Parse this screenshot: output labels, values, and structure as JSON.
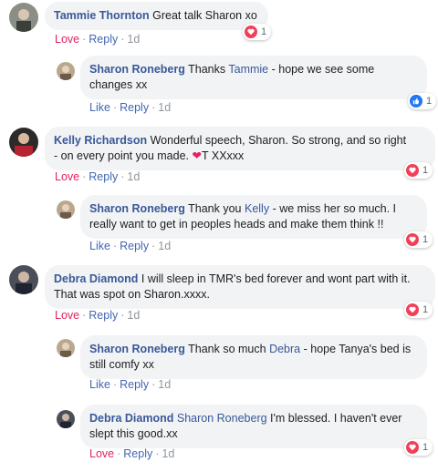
{
  "comments": [
    {
      "author": "Tammie Thornton",
      "text": "Great talk Sharon xo",
      "actions": {
        "love": "Love",
        "reply": "Reply",
        "time": "1d"
      },
      "reactions": {
        "type": "heart-icon",
        "count": "1"
      }
    },
    {
      "author": "Sharon Roneberg",
      "text_before": "Thanks",
      "mention": "Tammie",
      "text_after": "- hope we see some",
      "text_line2": "changes xx",
      "actions": {
        "like": "Like",
        "reply": "Reply",
        "time": "1d"
      },
      "reactions": {
        "type": "like-icon",
        "count": "1"
      }
    },
    {
      "author": "Kelly Richardson",
      "text": "Wonderful speech, Sharon. So strong, and so right",
      "text_line2_before": "- on every point you made.",
      "emoji": "heart-emoji",
      "emoji_char": "❤",
      "text_line2_after": "T XXxxx",
      "actions": {
        "love": "Love",
        "reply": "Reply",
        "time": "1d"
      },
      "reactions": {
        "type": "heart-icon",
        "count": "1"
      }
    },
    {
      "author": "Sharon Roneberg",
      "text_before": "Thank you",
      "mention": "Kelly",
      "text_after": "- we miss her so much. I",
      "text_line2": "really want to get in peoples heads and make them think !!",
      "actions": {
        "like": "Like",
        "reply": "Reply",
        "time": "1d"
      },
      "reactions": {
        "type": "heart-icon",
        "count": "1"
      }
    },
    {
      "author": "Debra Diamond",
      "text": "I will sleep in TMR's bed forever and wont part with it.",
      "text_line2": "That was spot on Sharon.xxxx.",
      "actions": {
        "love": "Love",
        "reply": "Reply",
        "time": "1d"
      },
      "reactions": {
        "type": "heart-icon",
        "count": "1"
      }
    },
    {
      "author": "Sharon Roneberg",
      "text_before": "Thank so much",
      "mention": "Debra",
      "text_after": "- hope Tanya's bed is",
      "text_line2": "still comfy xx",
      "actions": {
        "like": "Like",
        "reply": "Reply",
        "time": "1d"
      }
    },
    {
      "author": "Debra Diamond",
      "mention": "Sharon Roneberg",
      "text_after": "I'm blessed. I haven't ever",
      "text_line2": "slept this good.xx",
      "actions": {
        "love": "Love",
        "reply": "Reply",
        "time": "1d"
      },
      "reactions": {
        "type": "heart-icon",
        "count": "1"
      }
    }
  ],
  "colors": {
    "bubble": "#f2f3f5",
    "name": "#385898",
    "love": "#e0245e",
    "link": "#4267b2"
  }
}
